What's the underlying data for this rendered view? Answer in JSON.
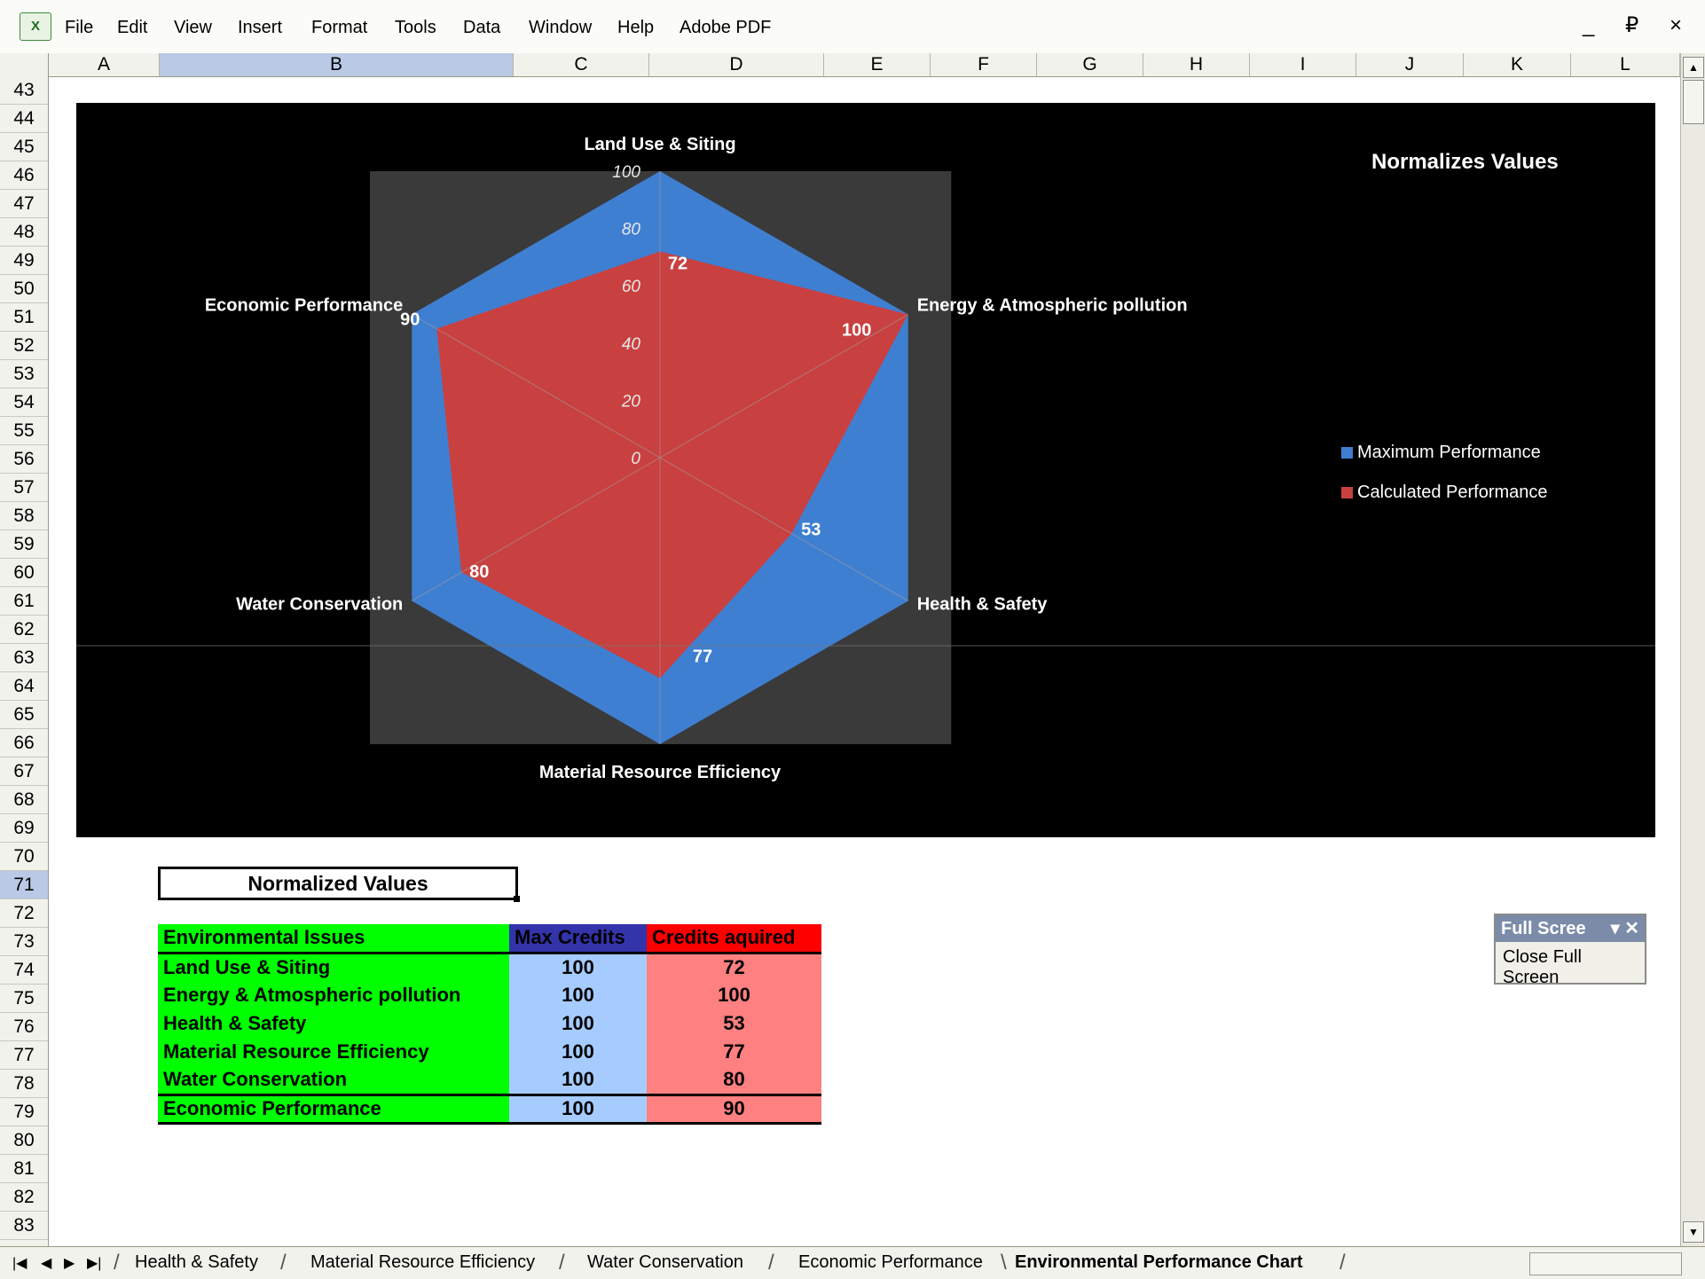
{
  "menu": {
    "items": [
      "File",
      "Edit",
      "View",
      "Insert",
      "Format",
      "Tools",
      "Data",
      "Window",
      "Help",
      "Adobe PDF"
    ],
    "window_controls": "_ ₽ ×"
  },
  "columns": [
    "A",
    "B",
    "C",
    "D",
    "E",
    "F",
    "G",
    "H",
    "I",
    "J",
    "K",
    "L"
  ],
  "rows": [
    "43",
    "44",
    "45",
    "46",
    "47",
    "48",
    "49",
    "50",
    "51",
    "52",
    "53",
    "54",
    "55",
    "56",
    "57",
    "58",
    "59",
    "60",
    "61",
    "62",
    "63",
    "64",
    "65",
    "66",
    "67",
    "68",
    "69",
    "70",
    "71",
    "72",
    "73",
    "74",
    "75",
    "76",
    "77",
    "78",
    "79",
    "80",
    "81",
    "82",
    "83"
  ],
  "selected": {
    "column": "B",
    "row": "71"
  },
  "chart_data": {
    "type": "radar",
    "title": "Normalizes Values",
    "categories": [
      "Land Use & Siting",
      "Energy & Atmospheric pollution",
      "Health & Safety",
      "Material Resource Efficiency",
      "Water Conservation",
      "Economic Performance"
    ],
    "series": [
      {
        "name": "Maximum Performance",
        "values": [
          100,
          100,
          100,
          100,
          100,
          100
        ],
        "color": "#3f7fd1"
      },
      {
        "name": "Calculated Performance",
        "values": [
          72,
          100,
          53,
          77,
          80,
          90
        ],
        "color": "#c94040"
      }
    ],
    "axis_ticks": [
      "0",
      "20",
      "40",
      "60",
      "80",
      "100"
    ],
    "range": [
      0,
      100
    ],
    "data_labels": [
      "72",
      "100",
      "53",
      "77",
      "80",
      "90"
    ],
    "legend_position": "right",
    "background": "#000000"
  },
  "table": {
    "title": "Normalized Values",
    "headers": [
      "Environmental Issues",
      "Max Credits",
      "Credits aquired"
    ],
    "rows": [
      [
        "Land Use & Siting",
        "100",
        "72"
      ],
      [
        "Energy & Atmospheric pollution",
        "100",
        "100"
      ],
      [
        "Health & Safety",
        "100",
        "53"
      ],
      [
        "Material Resource Efficiency",
        "100",
        "77"
      ],
      [
        "Water Conservation",
        "100",
        "80"
      ],
      [
        "Economic Performance",
        "100",
        "90"
      ]
    ]
  },
  "fullscreen_toolbar": {
    "title": "Full Scree",
    "controls": "▾ ✕",
    "button": "Close Full Screen"
  },
  "sheet_tabs": {
    "tabs": [
      "Health & Safety",
      "Material Resource Efficiency",
      "Water Conservation",
      "Economic Performance",
      "Environmental Performance Chart"
    ],
    "active": "Environmental Performance Chart"
  },
  "icons": {
    "app": "excel-icon",
    "tab_nav": [
      "first-sheet-icon",
      "prev-sheet-icon",
      "next-sheet-icon",
      "last-sheet-icon"
    ]
  }
}
